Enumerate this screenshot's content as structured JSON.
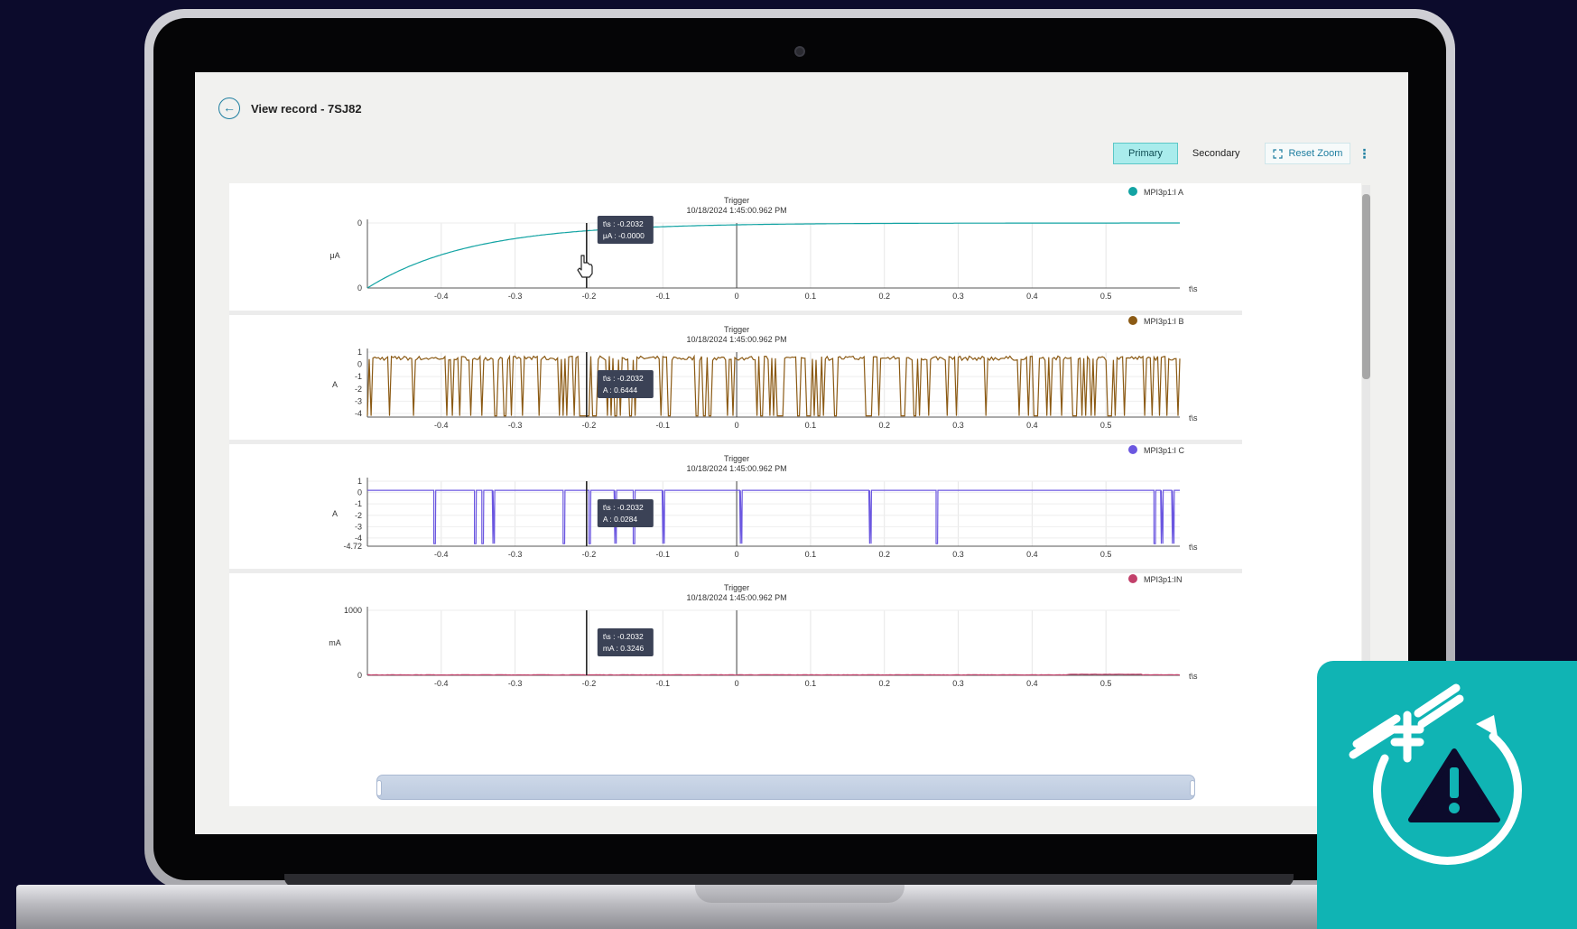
{
  "header": {
    "title": "View record - 7SJ82",
    "back_icon": "arrow-left-icon"
  },
  "toolbar": {
    "primary": "Primary",
    "secondary": "Secondary",
    "reset_zoom": "Reset Zoom",
    "more_icon": "kebab-icon",
    "reset_icon": "fullscreen-icon"
  },
  "chart_common": {
    "marker_title": "Trigger",
    "marker_time": "10/18/2024 1:45:00.962 PM",
    "x_unit": "t\\s",
    "cursor_x": -0.2032
  },
  "badge": {
    "icon": "fault-record-warning-icon"
  },
  "chart_data": [
    {
      "type": "line",
      "title": "Trigger",
      "subtitle": "10/18/2024 1:45:00.962 PM",
      "series_name": "MPI3p1:I A",
      "color": "#12a3a3",
      "ylabel": "μA",
      "xlabel": "t\\s",
      "xlim": [
        -0.5,
        0.6
      ],
      "x_ticks": [
        -0.4,
        -0.3,
        -0.2,
        -0.1,
        0,
        0.1,
        0.2,
        0.3,
        0.4,
        0.5
      ],
      "y_ticks": [
        0,
        0
      ],
      "ylim": [
        -1,
        0
      ],
      "shape": "exp_rise",
      "tooltip": [
        "t\\s : -0.2032",
        "μA : -0.0000"
      ]
    },
    {
      "type": "line",
      "title": "Trigger",
      "subtitle": "10/18/2024 1:45:00.962 PM",
      "series_name": "MPI3p1:I B",
      "color": "#8b5a14",
      "ylabel": "A",
      "xlabel": "t\\s",
      "xlim": [
        -0.5,
        0.6
      ],
      "x_ticks": [
        -0.4,
        -0.3,
        -0.2,
        -0.1,
        0,
        0.1,
        0.2,
        0.3,
        0.4,
        0.5
      ],
      "y_ticks": [
        1,
        0,
        -1,
        -2,
        -3,
        -4
      ],
      "ylim": [
        -4.3,
        1
      ],
      "shape": "dense_spikes",
      "tooltip": [
        "t\\s : -0.2032",
        "A : 0.6444"
      ]
    },
    {
      "type": "line",
      "title": "Trigger",
      "subtitle": "10/18/2024 1:45:00.962 PM",
      "series_name": "MPI3p1:I C",
      "color": "#6b57e0",
      "ylabel": "A",
      "xlabel": "t\\s",
      "xlim": [
        -0.5,
        0.6
      ],
      "x_ticks": [
        -0.4,
        -0.3,
        -0.2,
        -0.1,
        0,
        0.1,
        0.2,
        0.3,
        0.4,
        0.5
      ],
      "y_ticks": [
        1,
        0,
        -1,
        -2,
        -3,
        -4,
        -4.72
      ],
      "ylim": [
        -4.72,
        1
      ],
      "shape": "sparse_spikes",
      "tooltip": [
        "t\\s : -0.2032",
        "A : 0.0284"
      ]
    },
    {
      "type": "line",
      "title": "Trigger",
      "subtitle": "10/18/2024 1:45:00.962 PM",
      "series_name": "MPI3p1:IN",
      "color": "#c2406a",
      "ylabel": "mA",
      "xlabel": "t\\s",
      "xlim": [
        -0.5,
        0.6
      ],
      "x_ticks": [
        -0.4,
        -0.3,
        -0.2,
        -0.1,
        0,
        0.1,
        0.2,
        0.3,
        0.4,
        0.5
      ],
      "y_ticks": [
        1000,
        0
      ],
      "ylim": [
        0,
        1000
      ],
      "shape": "flat",
      "tooltip": [
        "t\\s : -0.2032",
        "mA : 0.3246"
      ]
    }
  ]
}
